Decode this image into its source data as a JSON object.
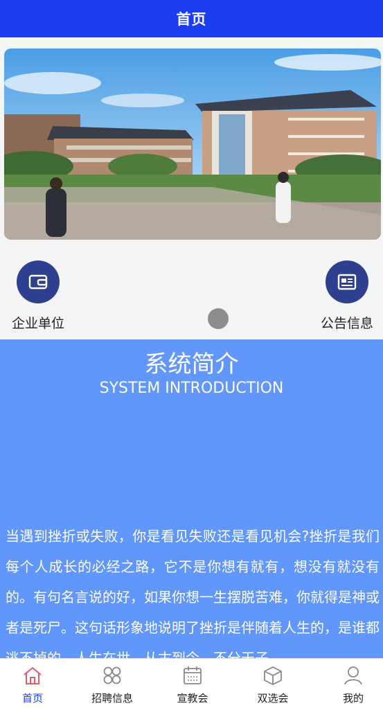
{
  "header": {
    "title": "首页"
  },
  "quick_links": [
    {
      "label": "企业单位",
      "icon": "wallet-icon"
    },
    {
      "label": "公告信息",
      "icon": "notice-card-icon"
    }
  ],
  "intro": {
    "title": "系统简介",
    "subtitle": "SYSTEM INTRODUCTION",
    "body": "当遇到挫折或失败，你是看见失败还是看见机会?挫折是我们每个人成长的必经之路，它不是你想有就有，想没有就没有的。有句名言说的好，如果你想一生摆脱苦难，你就得是神或者是死尸。这句话形象地说明了挫折是伴随着人生的，是谁都逃不掉的。人生在世，从古到今，不分天子"
  },
  "tabs": [
    {
      "label": "首页",
      "icon": "home-icon",
      "active": true
    },
    {
      "label": "招聘信息",
      "icon": "grid-icon",
      "active": false
    },
    {
      "label": "宣教会",
      "icon": "calendar-icon",
      "active": false
    },
    {
      "label": "双选会",
      "icon": "box-icon",
      "active": false
    },
    {
      "label": "我的",
      "icon": "user-icon",
      "active": false
    }
  ],
  "colors": {
    "header": "#1b3df0",
    "intro_bg": "#6196fb",
    "icon_circle": "#2e3f8f"
  }
}
